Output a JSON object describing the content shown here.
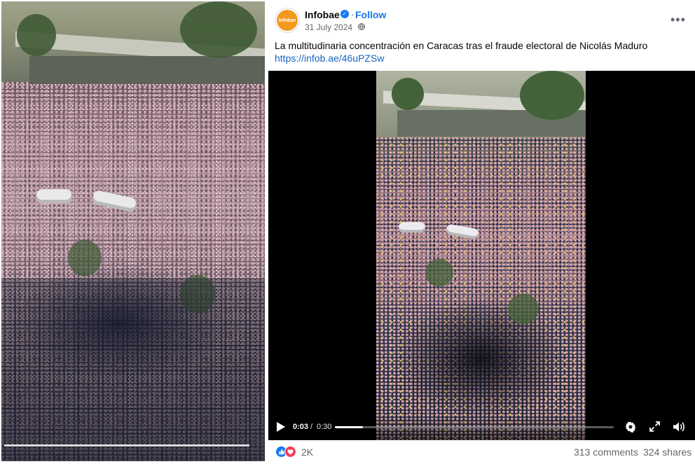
{
  "left_frame": {
    "description_colors": {
      "sky": "#8c8f6a",
      "crowd": "#a78c97",
      "shadow": "#2a2c38"
    }
  },
  "post": {
    "page_name": "Infobae",
    "avatar_text": "infobae",
    "follow_label": "Follow",
    "date": "31 July 2024",
    "caption": "La multitudinaria concentración en Caracas tras el fraude electoral de Nicolás Maduro",
    "link": "https://infob.ae/46uPZSw",
    "icons": {
      "verified": "verified-badge-icon",
      "audience": "globe-icon",
      "more": "more-options-icon"
    },
    "brand_color": "#1877f2"
  },
  "player": {
    "current_time": "0:03",
    "separator": "/",
    "total_time": "0:30",
    "progress": 0.1,
    "icons": [
      "play-icon",
      "settings-icon",
      "fullscreen-icon",
      "volume-icon"
    ]
  },
  "footer": {
    "reactions": [
      "like",
      "love"
    ],
    "reaction_count": "2K",
    "comments": "313 comments",
    "shares": "324 shares"
  }
}
